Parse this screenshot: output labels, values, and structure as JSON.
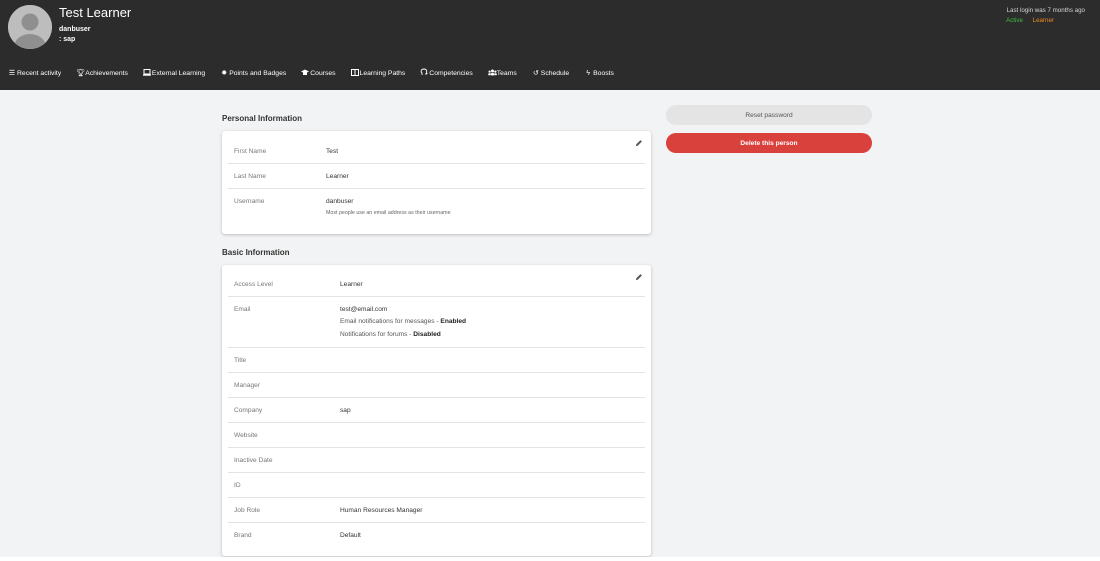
{
  "profile": {
    "name": "Test Learner",
    "username": "danbuser",
    "company": ": sap",
    "last_login": "Last login was 7 months ago",
    "status": "Active",
    "role": "Learner"
  },
  "nav": [
    {
      "label": "Recent activity",
      "icon": "list-icon"
    },
    {
      "label": "Achievements",
      "icon": "trophy-icon"
    },
    {
      "label": "External Learning",
      "icon": "laptop-icon"
    },
    {
      "label": "Points and Badges",
      "icon": "badge-icon"
    },
    {
      "label": "Courses",
      "icon": "graduation-cap-icon"
    },
    {
      "label": "Learning Paths",
      "icon": "book-icon"
    },
    {
      "label": "Competencies",
      "icon": "head-icon"
    },
    {
      "label": "Teams",
      "icon": "users-icon"
    },
    {
      "label": "Schedule",
      "icon": "history-icon"
    },
    {
      "label": "Boosts",
      "icon": "bolt-icon"
    }
  ],
  "personal": {
    "title": "Personal Information",
    "first_name_label": "First Name",
    "first_name": "Test",
    "last_name_label": "Last Name",
    "last_name": "Learner",
    "username_label": "Username",
    "username": "danbuser",
    "username_hint": "Most people use an email address as their username"
  },
  "basic": {
    "title": "Basic Information",
    "access_level_label": "Access Level",
    "access_level": "Learner",
    "email_label": "Email",
    "email": "test@email.com",
    "email_notifications_text": "Email notifications for messages - ",
    "email_notifications_value": "Enabled",
    "forum_notifications_text": "Notifications for forums - ",
    "forum_notifications_value": "Disabled",
    "title_label": "Title",
    "manager_label": "Manager",
    "company_label": "Company",
    "company": "sap",
    "website_label": "Website",
    "inactive_date_label": "Inactive Date",
    "id_label": "ID",
    "job_role_label": "Job Role",
    "job_role": "Human Resources Manager",
    "brand_label": "Brand",
    "brand": "Default"
  },
  "actions": {
    "reset_password": "Reset password",
    "delete_person": "Delete this person"
  },
  "colors": {
    "header_bg": "#2c2c2c",
    "active": "#3fbf3f",
    "role": "#f08a24",
    "delete": "#d9413d"
  }
}
